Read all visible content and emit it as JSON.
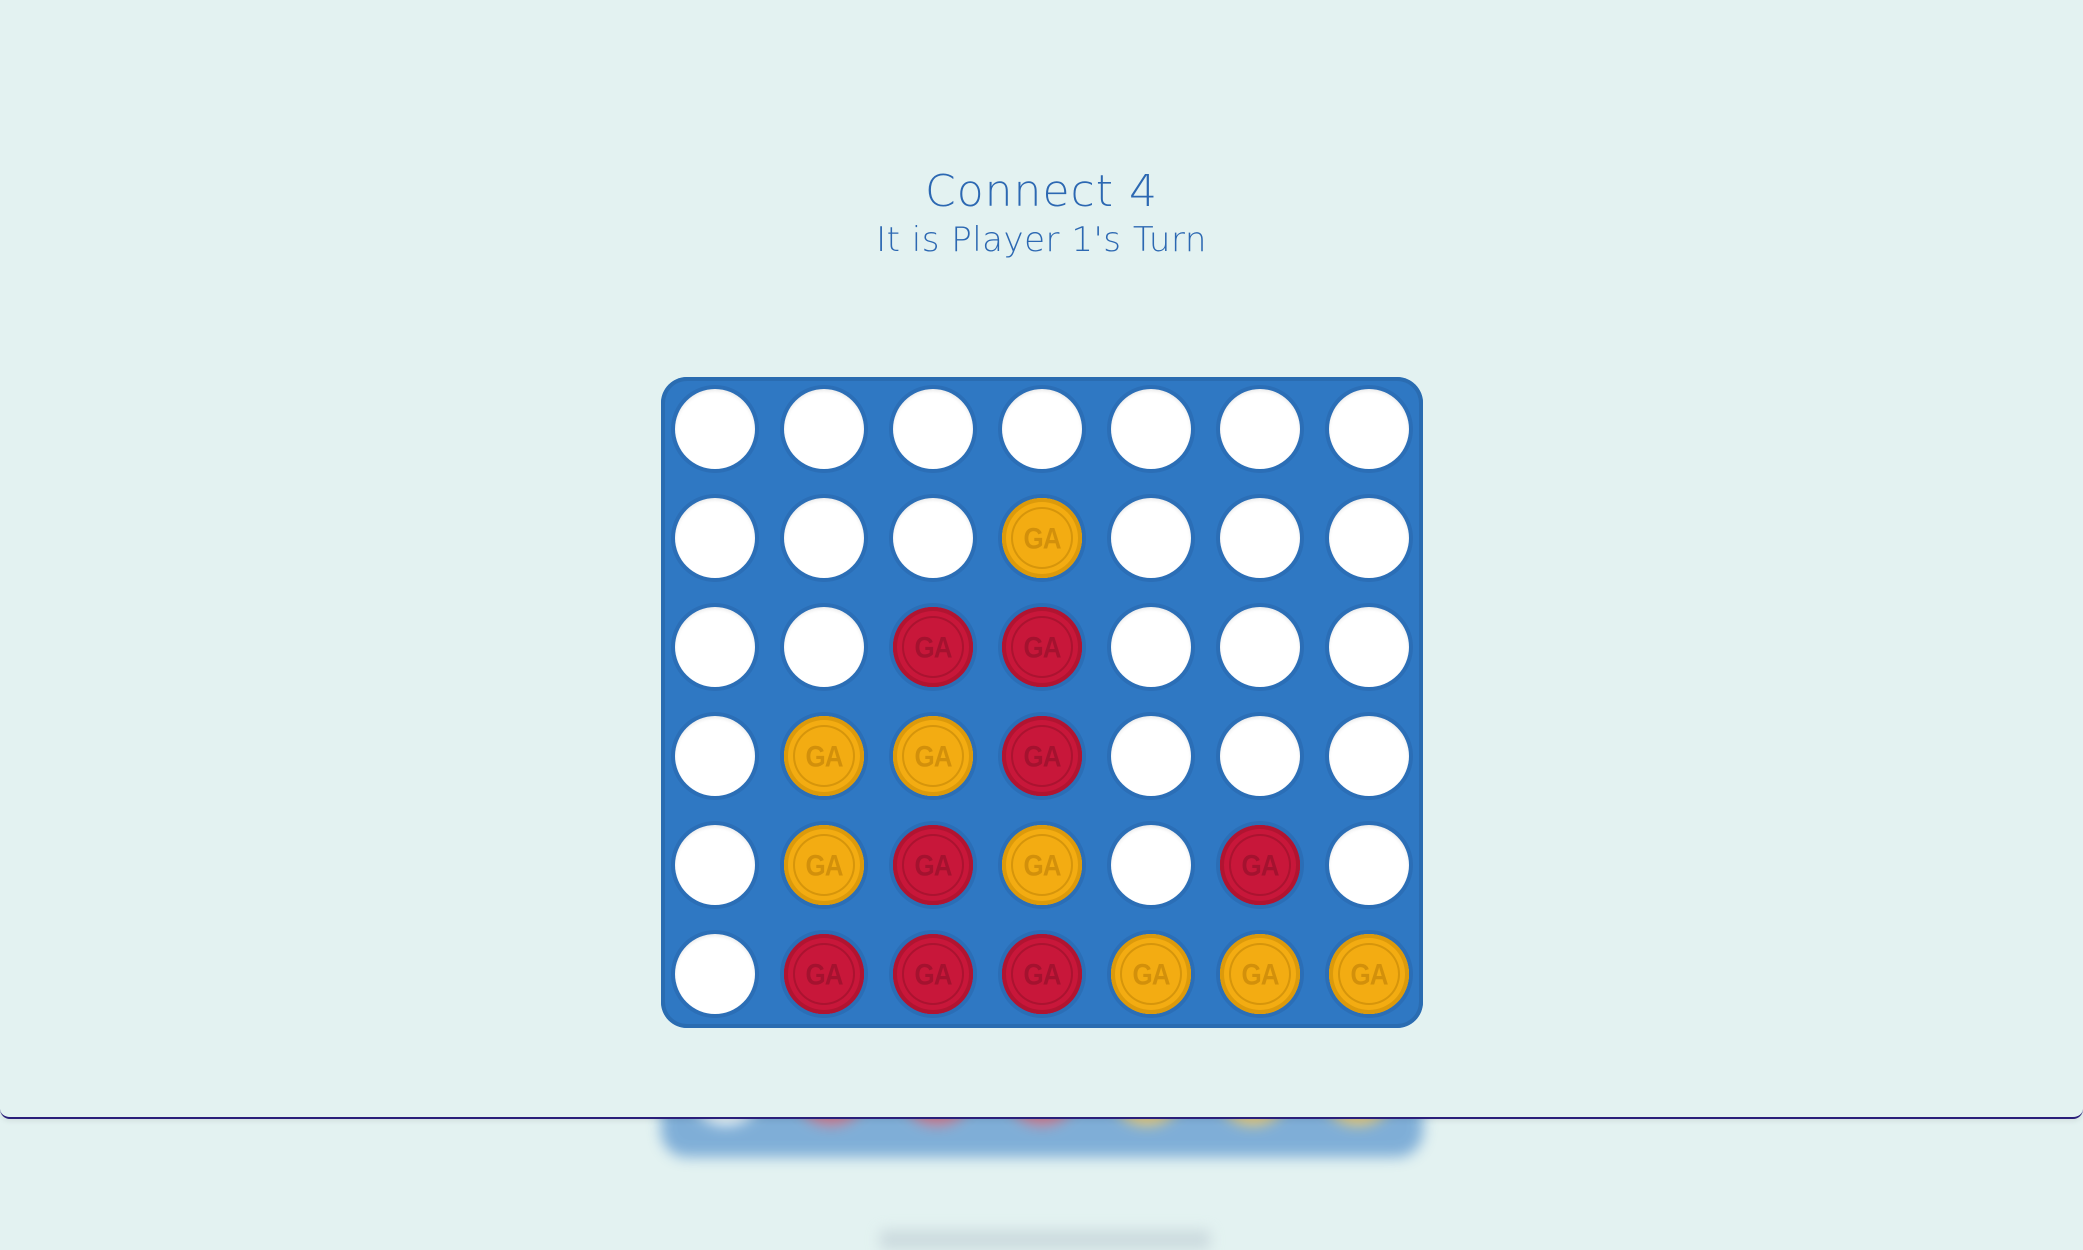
{
  "game": {
    "title": "Connect 4",
    "status": "It is Player 1's Turn"
  },
  "colors": {
    "background": "#e3f2f1",
    "board": "#2f78c3",
    "text": "#2c68b2",
    "player1": "#c8173a",
    "player2": "#f3ac12",
    "empty": "#ffffff"
  },
  "board": {
    "rows": 6,
    "cols": 7,
    "disc_mark": "GA",
    "cells": [
      [
        "empty",
        "empty",
        "empty",
        "empty",
        "empty",
        "empty",
        "empty"
      ],
      [
        "empty",
        "empty",
        "empty",
        "yellow",
        "empty",
        "empty",
        "empty"
      ],
      [
        "empty",
        "empty",
        "red",
        "red",
        "empty",
        "empty",
        "empty"
      ],
      [
        "empty",
        "yellow",
        "yellow",
        "red",
        "empty",
        "empty",
        "empty"
      ],
      [
        "empty",
        "yellow",
        "red",
        "yellow",
        "empty",
        "red",
        "empty"
      ],
      [
        "empty",
        "red",
        "red",
        "red",
        "yellow",
        "yellow",
        "yellow"
      ]
    ]
  },
  "ghost_bottom_row": [
    "empty",
    "red",
    "red",
    "red",
    "yellow",
    "yellow",
    "yellow"
  ]
}
